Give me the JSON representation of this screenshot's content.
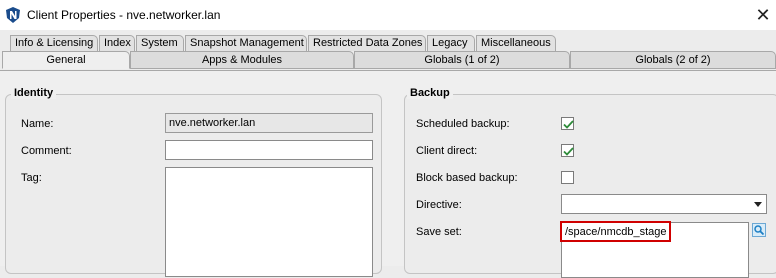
{
  "window": {
    "title": "Client Properties - nve.networker.lan",
    "close_glyph": "✕",
    "app_icon": "networker-shield-icon"
  },
  "tabs_row1": [
    {
      "label": "Info & Licensing"
    },
    {
      "label": "Index"
    },
    {
      "label": "System"
    },
    {
      "label": "Snapshot Management"
    },
    {
      "label": "Restricted Data Zones"
    },
    {
      "label": "Legacy"
    },
    {
      "label": "Miscellaneous"
    }
  ],
  "tabs_row2": [
    {
      "label": "General",
      "active": true
    },
    {
      "label": "Apps & Modules",
      "active": false
    },
    {
      "label": "Globals (1 of 2)",
      "active": false
    },
    {
      "label": "Globals (2 of 2)",
      "active": false
    }
  ],
  "identity": {
    "title": "Identity",
    "name_label": "Name:",
    "name_value": "nve.networker.lan",
    "comment_label": "Comment:",
    "comment_value": "",
    "tag_label": "Tag:",
    "tag_value": ""
  },
  "backup": {
    "title": "Backup",
    "scheduled_label": "Scheduled backup:",
    "scheduled_checked": true,
    "client_direct_label": "Client direct:",
    "client_direct_checked": true,
    "block_based_label": "Block based backup:",
    "block_based_checked": false,
    "directive_label": "Directive:",
    "directive_value": "",
    "save_set_label": "Save set:",
    "save_set_value": "/space/nmcdb_stage",
    "highlight_color": "#d00000"
  },
  "colors": {
    "check_green": "#2e8b3a",
    "search_blue": "#1e7fc4"
  }
}
